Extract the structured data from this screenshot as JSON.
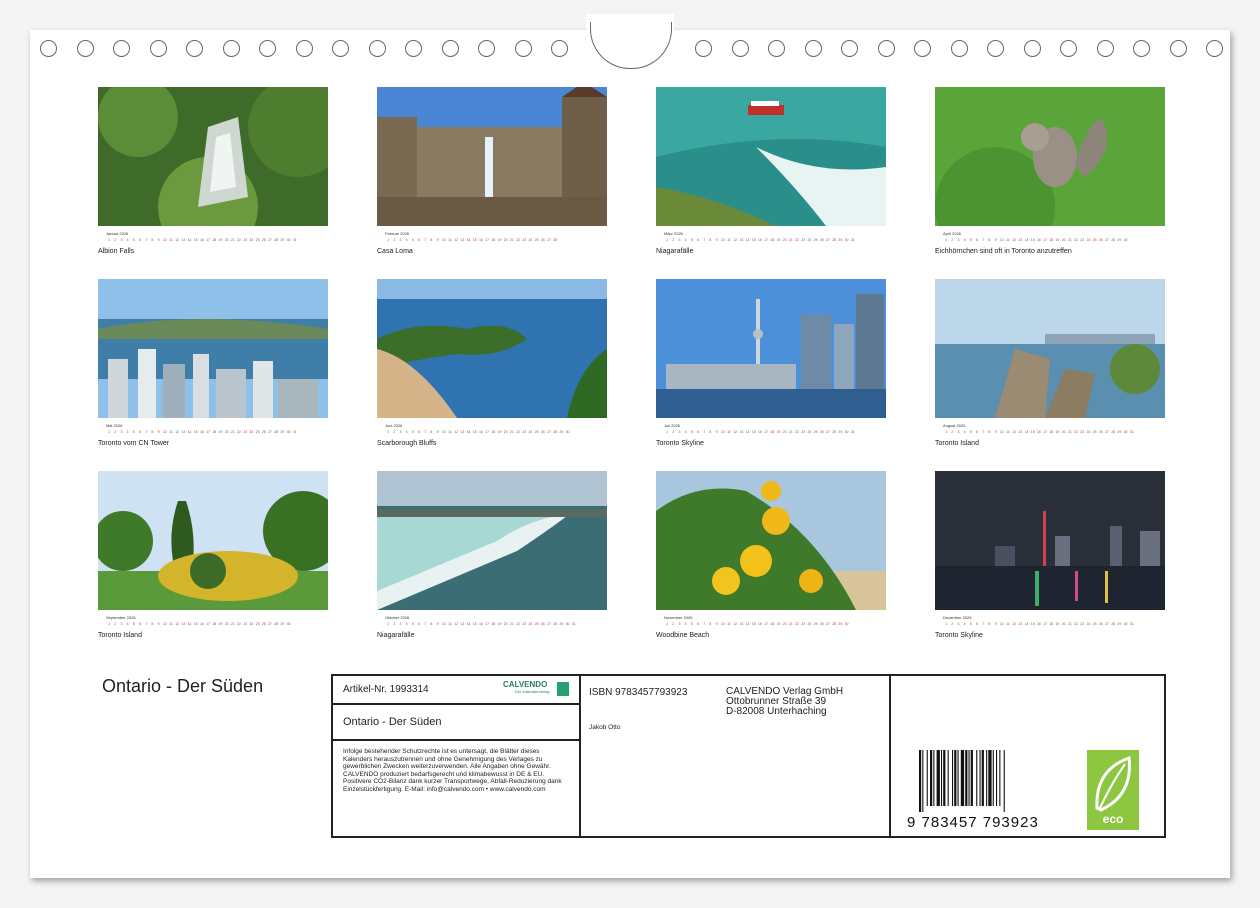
{
  "months": [
    {
      "name": "Januar",
      "year": "2026",
      "caption": "Albion Falls",
      "days": 31,
      "weekends": [
        3,
        4,
        10,
        11,
        17,
        18,
        24,
        25,
        31
      ]
    },
    {
      "name": "Februar",
      "year": "2026",
      "caption": "Casa Loma",
      "days": 28,
      "weekends": [
        1,
        7,
        8,
        14,
        15,
        21,
        22,
        28
      ]
    },
    {
      "name": "März",
      "year": "2026",
      "caption": "Niagarafälle",
      "days": 31,
      "weekends": [
        1,
        7,
        8,
        14,
        15,
        21,
        22,
        28,
        29
      ]
    },
    {
      "name": "April",
      "year": "2026",
      "caption": "Eichhörnchen sind oft in Toronto anzutreffen",
      "days": 30,
      "weekends": [
        4,
        5,
        11,
        12,
        18,
        19,
        25,
        26
      ]
    },
    {
      "name": "Mai",
      "year": "2026",
      "caption": "Toronto vom CN Tower",
      "days": 31,
      "weekends": [
        2,
        3,
        9,
        10,
        16,
        17,
        23,
        24,
        30,
        31
      ]
    },
    {
      "name": "Juni",
      "year": "2026",
      "caption": "Scarborough Bluffs",
      "days": 30,
      "weekends": [
        6,
        7,
        13,
        14,
        20,
        21,
        27,
        28
      ]
    },
    {
      "name": "Juli",
      "year": "2026",
      "caption": "Toronto Skyline",
      "days": 31,
      "weekends": [
        4,
        5,
        11,
        12,
        18,
        19,
        25,
        26
      ]
    },
    {
      "name": "August",
      "year": "2026",
      "caption": "Toronto Island",
      "days": 31,
      "weekends": [
        1,
        2,
        8,
        9,
        15,
        16,
        22,
        23,
        29,
        30
      ]
    },
    {
      "name": "September",
      "year": "2026",
      "caption": "Toronto Island",
      "days": 30,
      "weekends": [
        5,
        6,
        12,
        13,
        19,
        20,
        26,
        27
      ]
    },
    {
      "name": "Oktober",
      "year": "2026",
      "caption": "Niagarafälle",
      "days": 31,
      "weekends": [
        3,
        4,
        10,
        11,
        17,
        18,
        24,
        25,
        31
      ]
    },
    {
      "name": "November",
      "year": "2026",
      "caption": "Woodbine Beach",
      "days": 30,
      "weekends": [
        1,
        7,
        8,
        14,
        15,
        21,
        22,
        28,
        29
      ]
    },
    {
      "name": "Dezember",
      "year": "2026",
      "caption": "Toronto Skyline",
      "days": 31,
      "weekends": [
        5,
        6,
        12,
        13,
        19,
        20,
        26,
        27
      ]
    }
  ],
  "footer": {
    "title": "Ontario - Der Süden",
    "article_label": "Artikel-Nr. 1993314",
    "brand": "CALVENDO",
    "brand_sub": "Der Kalenderverlag",
    "book_title": "Ontario - Der Süden",
    "legal": "Infolge bestehender Schutzrechte ist es untersagt, die Blätter dieses Kalenders herauszutrennen und ohne Genehmigung des Verlages zu gewerblichen Zwecken weiterzuverwenden. Alle Angaben ohne Gewähr. CALVENDO produziert bedarfsgerecht und klimabewusst in DE & EU. Positivere CO2-Bilanz dank kurzer Transportwege, Abfall-Reduzierung dank Einzelstückfertigung. E-Mail: info@calvendo.com • www.calvendo.com",
    "isbn": "ISBN 9783457793923",
    "author": "Jakob Otto",
    "publisher_lines": [
      "CALVENDO Verlag GmbH",
      "Ottobrunner Straße 39",
      "D-82008 Unterhaching"
    ],
    "barcode_number": "9 783457 793923",
    "eco_label": "eco"
  },
  "colors": {
    "accent_green": "#8dc640",
    "weekend_red": "#cc3333"
  }
}
